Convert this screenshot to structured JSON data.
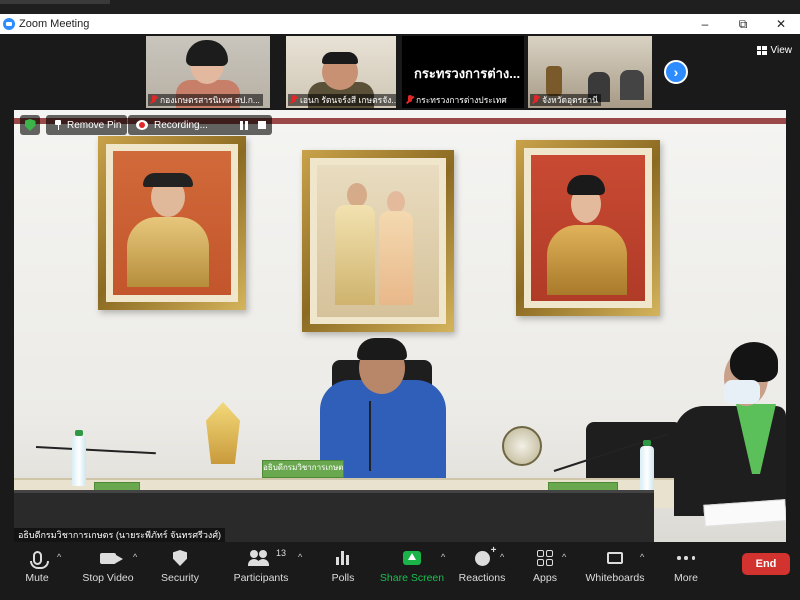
{
  "window": {
    "title": "Zoom Meeting",
    "controls": {
      "minimize": "–",
      "maximize": "⧉",
      "close": "✕"
    }
  },
  "gallery": {
    "tiles": [
      {
        "name": "กองเกษตรสารนิเทศ สป.ก..."
      },
      {
        "name": "เอนก รัตนจร์งสี เกษตรจัง..."
      },
      {
        "name": "กระทรวงการต่างประเทศ",
        "display_name": "กระทรวงการต่าง..."
      },
      {
        "name": "จังหวัดอุดรธานี"
      }
    ],
    "view_label": "View"
  },
  "main": {
    "remove_pin_label": "Remove Pin",
    "recording_label": "Recording...",
    "speaker_name": "อธิบดีกรมวิชาการเกษตร (นายระพีภัทร์ จันทรศรีวงศ์)",
    "nameplate_center": "อธิบดีกรมวิชาการเกษตร",
    "nameplate_left": "",
    "nameplate_right": ""
  },
  "toolbar": {
    "items": [
      {
        "label": "Mute",
        "icon": "microphone-icon"
      },
      {
        "label": "Stop Video",
        "icon": "video-camera-icon"
      },
      {
        "label": "Security",
        "icon": "shield-icon"
      },
      {
        "label": "Participants",
        "icon": "participants-icon",
        "count": "13"
      },
      {
        "label": "Polls",
        "icon": "polls-icon"
      },
      {
        "label": "Share Screen",
        "icon": "share-screen-icon"
      },
      {
        "label": "Reactions",
        "icon": "reactions-icon"
      },
      {
        "label": "Apps",
        "icon": "apps-icon"
      },
      {
        "label": "Whiteboards",
        "icon": "whiteboard-icon"
      },
      {
        "label": "More",
        "icon": "more-icon"
      }
    ],
    "end_label": "End"
  },
  "colors": {
    "brand": "#2d8cff",
    "end_button": "#d2332f",
    "share_green": "#19b34a",
    "muted_red": "#e02828"
  }
}
